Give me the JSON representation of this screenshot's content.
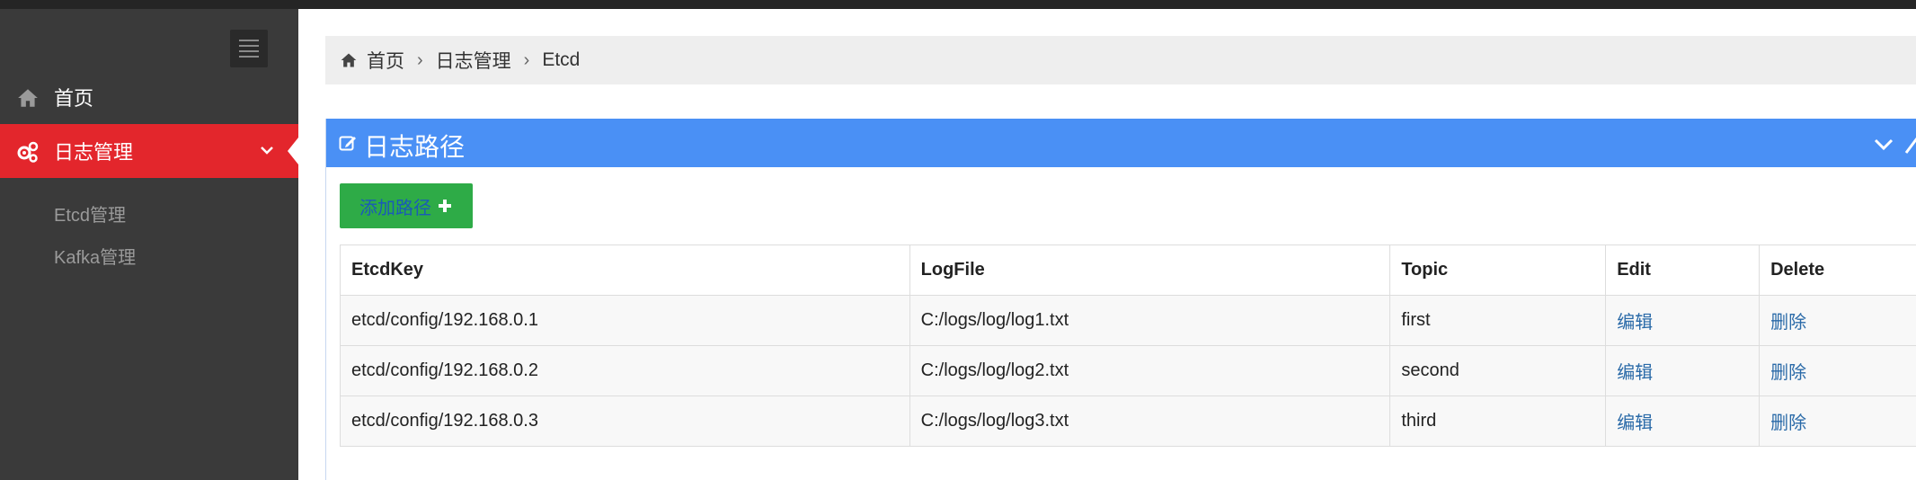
{
  "sidebar": {
    "items": [
      {
        "label": "首页",
        "icon": "home-icon"
      },
      {
        "label": "日志管理",
        "icon": "gears-icon",
        "active": true,
        "color": "#e3262c"
      }
    ],
    "subitems": [
      {
        "label": "Etcd管理"
      },
      {
        "label": "Kafka管理"
      }
    ]
  },
  "breadcrumb": {
    "home": "首页",
    "level1": "日志管理",
    "level2": "Etcd"
  },
  "panel": {
    "title": "日志路径",
    "header_color": "#4a90f5"
  },
  "add_button": {
    "label": "添加路径",
    "color": "#2eab47"
  },
  "table": {
    "columns": [
      "EtcdKey",
      "LogFile",
      "Topic",
      "Edit",
      "Delete"
    ],
    "rows": [
      {
        "key": "etcd/config/192.168.0.1",
        "logfile": "C:/logs/log/log1.txt",
        "topic": "first",
        "edit": "编辑",
        "delete": "删除"
      },
      {
        "key": "etcd/config/192.168.0.2",
        "logfile": "C:/logs/log/log2.txt",
        "topic": "second",
        "edit": "编辑",
        "delete": "删除"
      },
      {
        "key": "etcd/config/192.168.0.3",
        "logfile": "C:/logs/log/log3.txt",
        "topic": "third",
        "edit": "编辑",
        "delete": "删除"
      }
    ]
  }
}
